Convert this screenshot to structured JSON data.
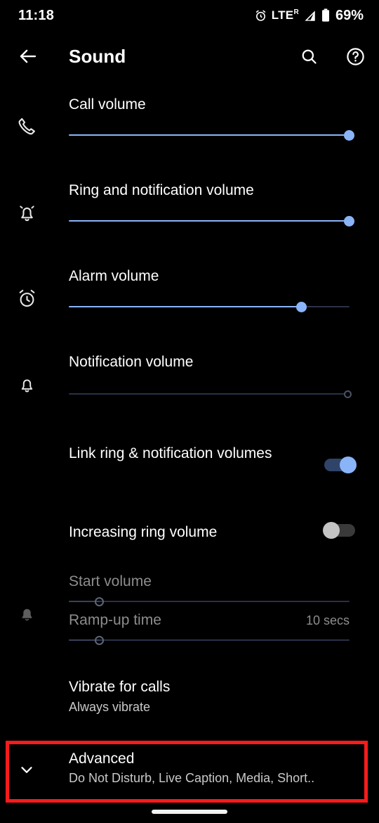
{
  "status_bar": {
    "time": "11:18",
    "alarm_icon": "alarm-clock-icon",
    "network_label": "LTE",
    "roaming_label": "R",
    "signal_icon": "signal-bars-icon",
    "battery_icon": "battery-icon",
    "battery_percent": "69%"
  },
  "app_bar": {
    "back_icon": "arrow-left-icon",
    "title": "Sound",
    "search_icon": "search-icon",
    "help_icon": "help-circle-icon"
  },
  "volume_sliders": [
    {
      "icon": "phone-icon",
      "label": "Call volume",
      "value_percent": 100,
      "enabled": true
    },
    {
      "icon": "bell-ring-icon",
      "label": "Ring and notification volume",
      "value_percent": 100,
      "enabled": true
    },
    {
      "icon": "alarm-clock-icon",
      "label": "Alarm volume",
      "value_percent": 83,
      "enabled": true
    },
    {
      "icon": "bell-icon",
      "label": "Notification volume",
      "value_percent": 100,
      "enabled": false
    }
  ],
  "toggles": [
    {
      "label": "Link ring & notification volumes",
      "state": "on"
    },
    {
      "label": "Increasing ring volume",
      "state": "off"
    }
  ],
  "increasing_ring_group": {
    "icon": "bell-muted-icon",
    "enabled": false,
    "items": [
      {
        "label": "Start volume",
        "value_percent": 11,
        "value_text": ""
      },
      {
        "label": "Ramp-up time",
        "value_percent": 11,
        "value_text": "10 secs"
      }
    ]
  },
  "vibrate_row": {
    "label": "Vibrate for calls",
    "sublabel": "Always vibrate"
  },
  "advanced_row": {
    "icon": "chevron-down-icon",
    "label": "Advanced",
    "sublabel": "Do Not Disturb, Live Caption, Media, Short.."
  },
  "highlight": {
    "color": "#f71b1b"
  },
  "nav_bar": {
    "home_indicator": "home-gesture-pill"
  },
  "colors": {
    "background": "#000000",
    "accent": "#8ab4f8",
    "text_primary": "#ffffff",
    "text_secondary": "#c9c9c9",
    "text_disabled": "#8d8d8d",
    "highlight": "#f71b1b"
  }
}
